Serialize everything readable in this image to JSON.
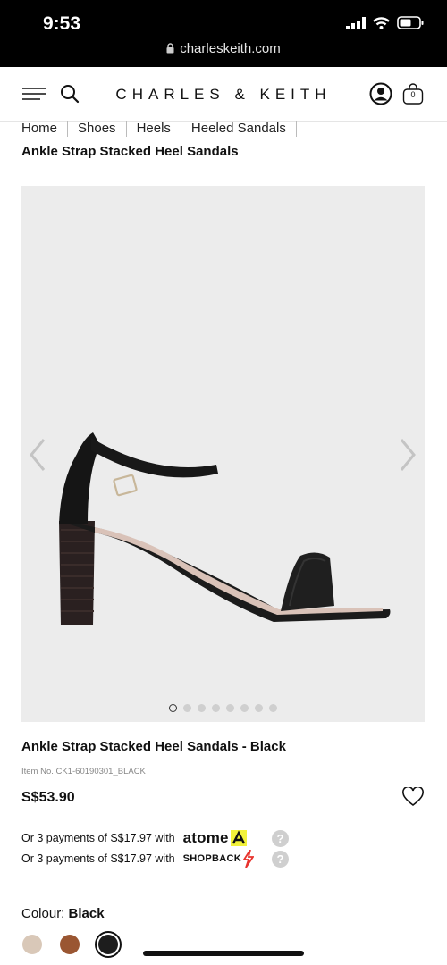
{
  "status_bar": {
    "time": "9:53",
    "url": "charleskeith.com"
  },
  "header": {
    "brand": "CHARLES & KEITH",
    "cart_count": "0"
  },
  "breadcrumb": [
    "Home",
    "Shoes",
    "Heels",
    "Heeled Sandals"
  ],
  "page_title": "Ankle Strap Stacked Heel Sandals",
  "gallery": {
    "image_count": 8,
    "active_index": 0
  },
  "product": {
    "name": "Ankle Strap Stacked Heel Sandals - Black",
    "item_no": "Item No. CK1-60190301_BLACK",
    "price": "S$53.90"
  },
  "payments": [
    {
      "text": "Or 3 payments of S$17.97 with",
      "provider": "atome",
      "help": "?"
    },
    {
      "text": "Or 3 payments of S$17.97 with",
      "provider": "SHOPBACK",
      "help": "?"
    }
  ],
  "colour": {
    "label": "Colour:",
    "selected": "Black",
    "swatches": [
      {
        "name": "Beige",
        "color": "#d9c8b8"
      },
      {
        "name": "Brown",
        "color": "#9a5632"
      },
      {
        "name": "Black",
        "color": "#1d1d1d"
      }
    ]
  },
  "colors": {
    "atome_accent": "#f2f23a",
    "shopback_accent": "#e8332d"
  }
}
